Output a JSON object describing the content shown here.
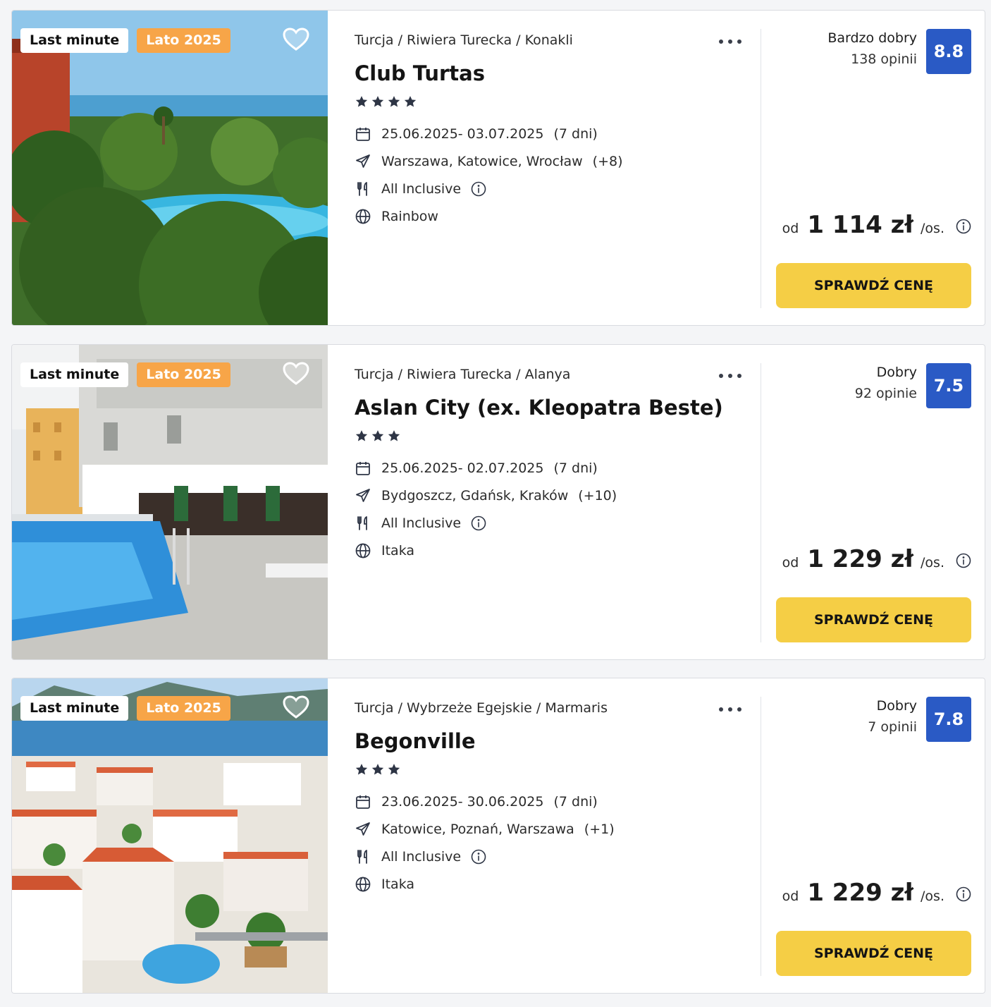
{
  "offers": [
    {
      "badges": [
        "Last minute",
        "Lato 2025"
      ],
      "breadcrumb": "Turcja / Riwiera Turecka / Konakli",
      "name": "Club Turtas",
      "stars": 4,
      "dates": "25.06.2025- 03.07.2025",
      "duration": "(7 dni)",
      "departure_cities": "Warszawa, Katowice, Wrocław",
      "departure_more": "(+8)",
      "board": "All Inclusive",
      "operator": "Rainbow",
      "rating_label": "Bardzo dobry",
      "rating_count": "138 opinii",
      "score": "8.8",
      "price_prefix": "od",
      "price": "1 114 zł",
      "price_suffix": "/os.",
      "cta": "SPRAWDŹ CENĘ",
      "photo_theme": "garden-pool"
    },
    {
      "badges": [
        "Last minute",
        "Lato 2025"
      ],
      "breadcrumb": "Turcja / Riwiera Turecka / Alanya",
      "name": "Aslan City (ex. Kleopatra Beste)",
      "stars": 3,
      "dates": "25.06.2025- 02.07.2025",
      "duration": "(7 dni)",
      "departure_cities": "Bydgoszcz, Gdańsk, Kraków",
      "departure_more": "(+10)",
      "board": "All Inclusive",
      "operator": "Itaka",
      "rating_label": "Dobry",
      "rating_count": "92 opinie",
      "score": "7.5",
      "price_prefix": "od",
      "price": "1 229 zł",
      "price_suffix": "/os.",
      "cta": "SPRAWDŹ CENĘ",
      "photo_theme": "hotel-pool"
    },
    {
      "badges": [
        "Last minute",
        "Lato 2025"
      ],
      "breadcrumb": "Turcja / Wybrzeże Egejskie / Marmaris",
      "name": "Begonville",
      "stars": 3,
      "dates": "23.06.2025- 30.06.2025",
      "duration": "(7 dni)",
      "departure_cities": "Katowice, Poznań, Warszawa",
      "departure_more": "(+1)",
      "board": "All Inclusive",
      "operator": "Itaka",
      "rating_label": "Dobry",
      "rating_count": "7 opinii",
      "score": "7.8",
      "price_prefix": "od",
      "price": "1 229 zł",
      "price_suffix": "/os.",
      "cta": "SPRAWDŹ CENĘ",
      "photo_theme": "coastal-town"
    }
  ],
  "icons": {
    "favorite": "heart-icon",
    "more": "more-dots-icon",
    "star": "star-icon",
    "dates": "calendar-icon",
    "departure": "plane-icon",
    "board": "cutlery-icon",
    "info": "info-icon",
    "operator": "globe-icon"
  },
  "colors": {
    "score_badge": "#2a5ac5",
    "cta": "#f5ce45",
    "season_badge": "#f7a548",
    "border": "#d9dbe0"
  }
}
